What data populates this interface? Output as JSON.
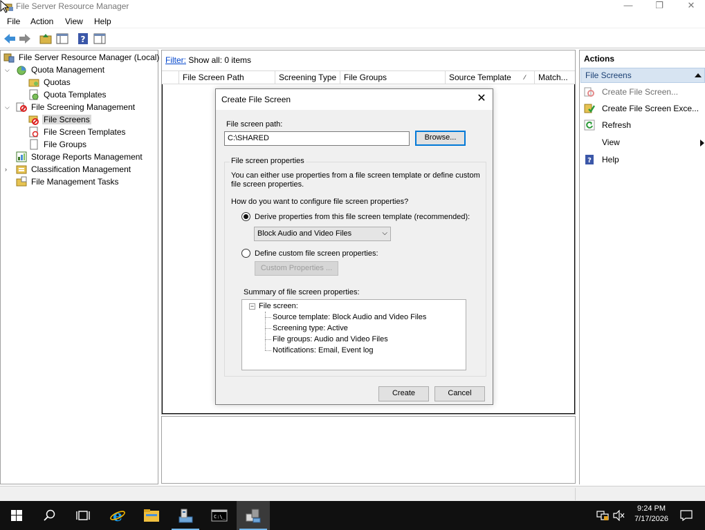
{
  "window": {
    "title": "File Server Resource Manager"
  },
  "menu": [
    "File",
    "Action",
    "View",
    "Help"
  ],
  "tree": {
    "root": "File Server Resource Manager (Local)",
    "quota_management": "Quota Management",
    "quotas": "Quotas",
    "quota_templates": "Quota Templates",
    "file_screening_management": "File Screening Management",
    "file_screens": "File Screens",
    "file_screen_templates": "File Screen Templates",
    "file_groups": "File Groups",
    "storage_reports": "Storage Reports Management",
    "classification": "Classification Management",
    "file_management_tasks": "File Management Tasks"
  },
  "center": {
    "filter_label": "Filter:",
    "filter_value": " Show all: 0 items",
    "columns": [
      "File Screen Path",
      "Screening Type",
      "File Groups",
      "Source Template",
      "Match..."
    ]
  },
  "actions": {
    "header": "Actions",
    "section": "File Screens",
    "items": [
      {
        "label": "Create File Screen...",
        "icon": "create-file-screen-icon",
        "enabled": false
      },
      {
        "label": "Create File Screen Exce...",
        "icon": "create-exception-icon",
        "enabled": true
      },
      {
        "label": "Refresh",
        "icon": "refresh-icon",
        "enabled": true
      },
      {
        "label": "View",
        "icon": "",
        "enabled": true
      },
      {
        "label": "Help",
        "icon": "help-icon",
        "enabled": true
      }
    ]
  },
  "dialog": {
    "title": "Create File Screen",
    "path_label": "File screen path:",
    "path_value": "C:\\SHARED",
    "browse": "Browse...",
    "group_title": "File screen properties",
    "description_1": "You can either use properties from a file screen template or define custom",
    "description_2": "file screen properties.",
    "question": "How do you want to configure file screen properties?",
    "radio_derive": "Derive properties from this file screen template (recommended):",
    "template_selected": "Block Audio and Video Files",
    "radio_custom": "Define custom file screen properties:",
    "custom_button": "Custom Properties ...",
    "summary_label": "Summary of file screen properties:",
    "summary": {
      "root": "File screen:",
      "source_template": "Source template: Block Audio and Video Files",
      "screening_type": "Screening type: Active",
      "file_groups": "File groups: Audio and Video Files",
      "notifications": "Notifications: Email, Event log"
    },
    "create": "Create",
    "cancel": "Cancel"
  },
  "taskbar": {
    "time": "9:24 PM",
    "date": "7/17/2026"
  }
}
